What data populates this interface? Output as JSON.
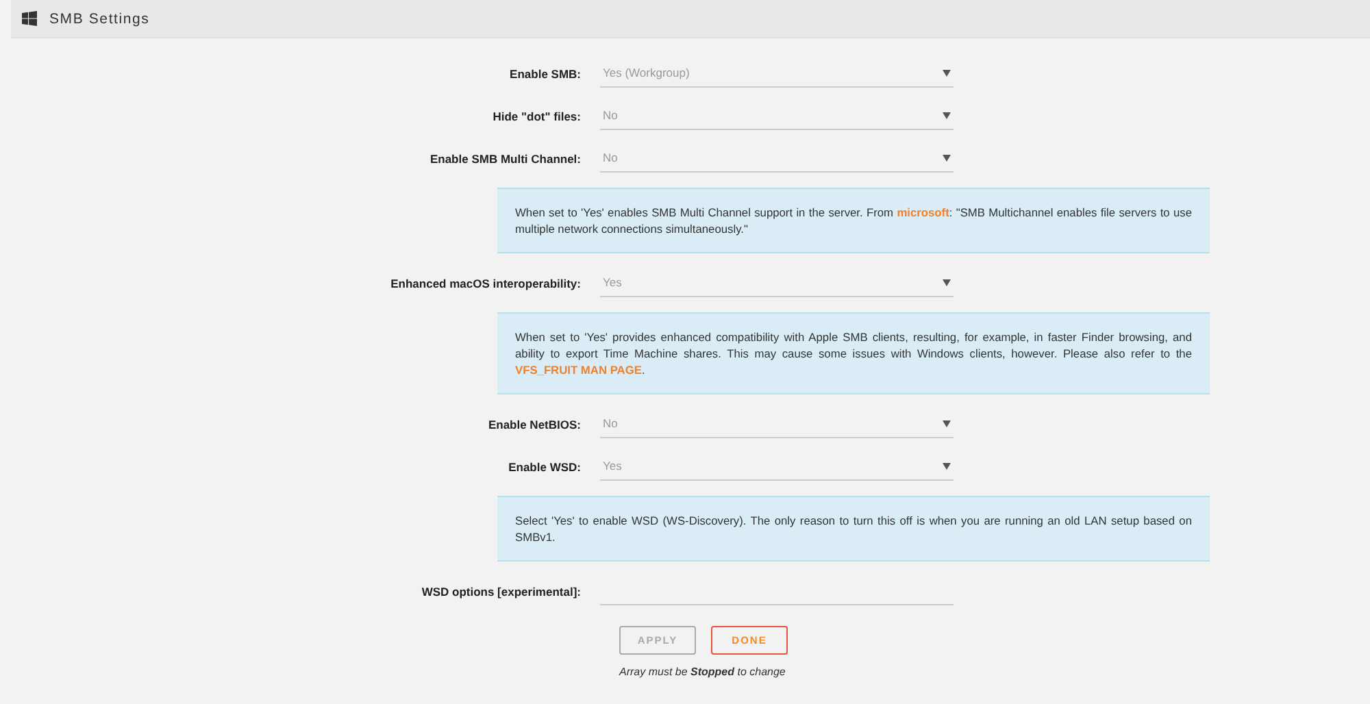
{
  "header": {
    "title": "SMB Settings"
  },
  "rows": [
    {
      "kind": "select",
      "label": "Enable SMB:",
      "value": "Yes (Workgroup)",
      "disabled": true
    },
    {
      "kind": "select",
      "label": "Hide \"dot\" files:",
      "value": "No",
      "disabled": true
    },
    {
      "kind": "select",
      "label": "Enable SMB Multi Channel:",
      "value": "No",
      "disabled": true
    },
    {
      "kind": "info",
      "parts": [
        {
          "kind": "text",
          "text": "When set to 'Yes' enables SMB Multi Channel support in the server. From "
        },
        {
          "kind": "link",
          "text": "microsoft"
        },
        {
          "kind": "text",
          "text": ": \"SMB Multichannel enables file servers to use multiple network connections simultaneously.\""
        }
      ]
    },
    {
      "kind": "select",
      "label": "Enhanced macOS interoperability:",
      "value": "Yes",
      "disabled": true
    },
    {
      "kind": "info",
      "parts": [
        {
          "kind": "text",
          "text": "When set to 'Yes' provides enhanced compatibility with Apple SMB clients, resulting, for example, in faster Finder browsing, and ability to export Time Machine shares. This may cause some issues with Windows clients, however. Please also refer to the "
        },
        {
          "kind": "link",
          "text": "VFS_FRUIT MAN PAGE"
        },
        {
          "kind": "text",
          "text": "."
        }
      ]
    },
    {
      "kind": "select",
      "label": "Enable NetBIOS:",
      "value": "No",
      "disabled": true
    },
    {
      "kind": "select",
      "label": "Enable WSD:",
      "value": "Yes",
      "disabled": true
    },
    {
      "kind": "info",
      "parts": [
        {
          "kind": "text",
          "text": "Select 'Yes' to enable WSD (WS-Discovery). The only reason to turn this off is when you are running an old LAN setup based on SMBv1."
        }
      ]
    },
    {
      "kind": "text",
      "label": "WSD options [experimental]:"
    }
  ],
  "buttons": [
    {
      "label": "APPLY",
      "kind": "apply",
      "disabled": true
    },
    {
      "label": "DONE",
      "kind": "done",
      "disabled": false
    }
  ],
  "note": "Array must be **Stopped** to change"
}
